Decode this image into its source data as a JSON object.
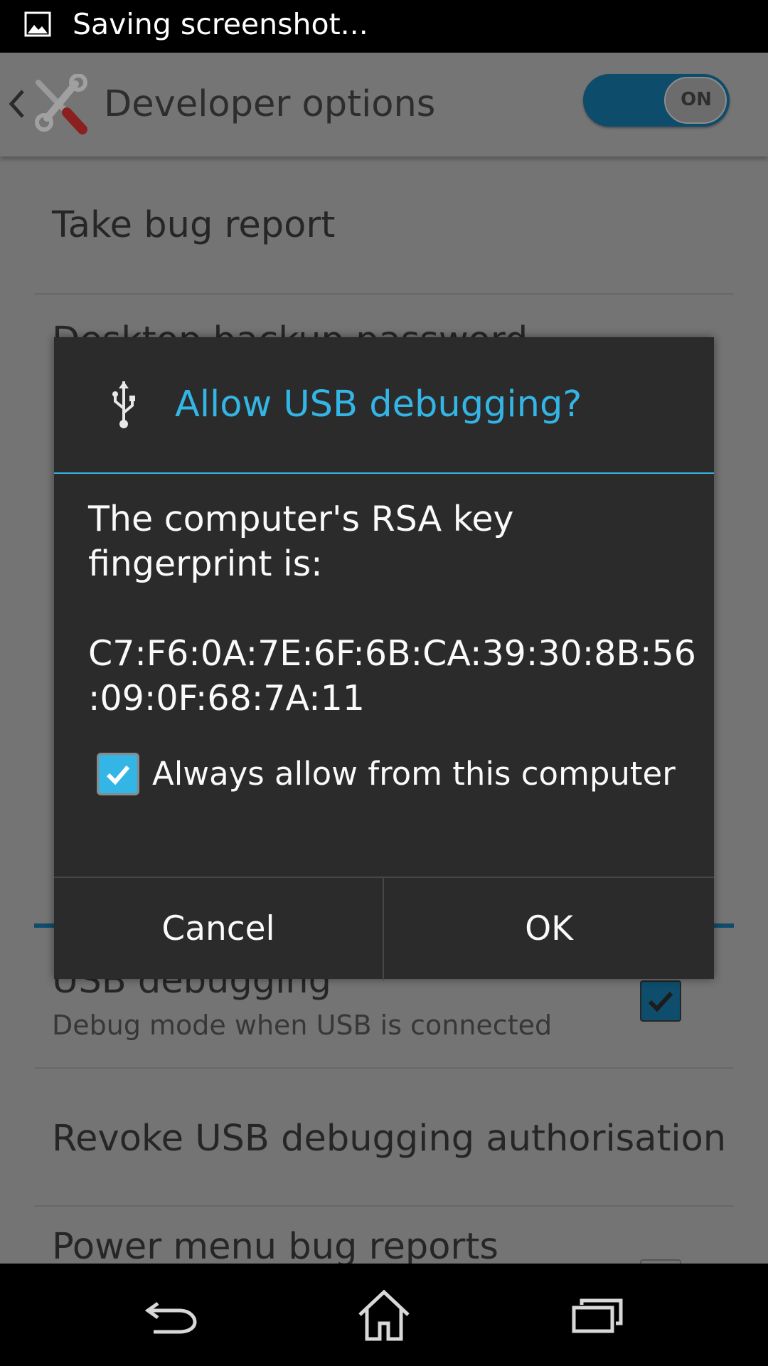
{
  "status_bar": {
    "notification_text": "Saving screenshot..."
  },
  "action_bar": {
    "title": "Developer options",
    "toggle_label": "ON"
  },
  "list": {
    "take_bug_report": "Take bug report",
    "partial_item_1": "Desktop backup password",
    "usb_debugging_title": "USB debugging",
    "usb_debugging_summary": "Debug mode when USB is connected",
    "revoke_usb": "Revoke USB debugging authorisation",
    "power_menu": "Power menu bug reports"
  },
  "dialog": {
    "title": "Allow USB debugging?",
    "message_line1": "The computer's RSA key",
    "message_line2": "fingerprint is:",
    "fingerprint_line1": "C7:F6:0A:7E:6F:6B:CA:39:30:8B:56",
    "fingerprint_line2": ":09:0F:68:7A:11",
    "checkbox_label": "Always allow from this computer",
    "checkbox_checked": true,
    "cancel_label": "Cancel",
    "ok_label": "OK"
  },
  "colors": {
    "accent": "#33b5e5",
    "dialog_bg": "#2b2b2b",
    "scrim_bg": "#747474"
  },
  "icons": {
    "status_notification": "image-icon",
    "action_back": "chevron-left-icon",
    "app_icon": "tools-icon",
    "dialog_icon": "usb-icon",
    "nav_back": "back-arrow-icon",
    "nav_home": "home-icon",
    "nav_recent": "recent-apps-icon"
  }
}
